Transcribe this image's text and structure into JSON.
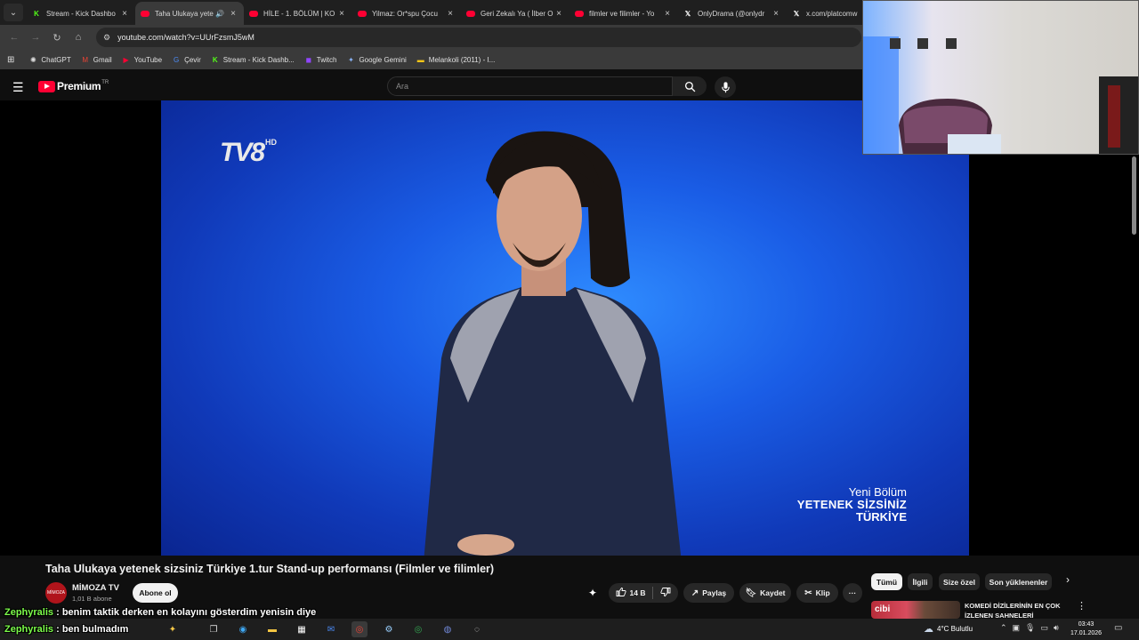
{
  "tabs": [
    {
      "title": "Stream - Kick Dashbo",
      "favicon": "kick-icon",
      "active": false
    },
    {
      "title": "Taha Ulukaya yete",
      "favicon": "youtube-icon",
      "active": true,
      "audio": true
    },
    {
      "title": "HİLE - 1. BÖLÜM | KO",
      "favicon": "youtube-icon",
      "active": false
    },
    {
      "title": "Yilmaz: Or*spu Çocu",
      "favicon": "youtube-icon",
      "active": false
    },
    {
      "title": "Geri Zekalı Ya ( İlber O",
      "favicon": "youtube-icon",
      "active": false
    },
    {
      "title": "filmler ve filimler - Yo",
      "favicon": "youtube-icon",
      "active": false
    },
    {
      "title": "OnlyDrama (@onlydr",
      "favicon": "x-icon",
      "active": false
    },
    {
      "title": "x.com/platcomw",
      "favicon": "x-icon",
      "active": false
    }
  ],
  "address": {
    "url": "youtube.com/watch?v=UUrFzsmJ5wM"
  },
  "bookmarks": [
    {
      "label": "ChatGPT",
      "icon": "chatgpt-icon"
    },
    {
      "label": "Gmail",
      "icon": "gmail-icon"
    },
    {
      "label": "YouTube",
      "icon": "youtube-icon"
    },
    {
      "label": "Çevir",
      "icon": "translate-icon"
    },
    {
      "label": "Stream - Kick Dashb...",
      "icon": "kick-icon"
    },
    {
      "label": "Twitch",
      "icon": "twitch-icon"
    },
    {
      "label": "Google Gemini",
      "icon": "gemini-icon"
    },
    {
      "label": "Melankoli (2011) - I...",
      "icon": "imdb-icon"
    }
  ],
  "masthead": {
    "brand": "Premium",
    "country": "TR",
    "search_placeholder": "Ara"
  },
  "video": {
    "channel_logo": "TV8",
    "channel_logo_hd": "HD",
    "caption_line1": "Yeni Bölüm",
    "caption_line2": "YETENEK SİZSİNİZ",
    "caption_line3": "TÜRKİYE"
  },
  "meta": {
    "title": "Taha Ulukaya yetenek sizsiniz Türkiye 1.tur Stand-up performansı (Filmler ve filimler)",
    "channel": "MİMOZA TV",
    "avatar_text": "MİMOZA",
    "subscribers": "1,01 B abone",
    "subscribe_label": "Abone ol",
    "likes": "14 B",
    "share_label": "Paylaş",
    "save_label": "Kaydet",
    "clip_label": "Klip",
    "more_label": "···"
  },
  "chips": [
    "Tümü",
    "İlgili",
    "Size özel",
    "Son yüklenenler"
  ],
  "recommendation": {
    "thumb_text": "cibi",
    "title": "KOMEDİ DİZİLERİNİN EN ÇOK İZLENEN SAHNELERİ"
  },
  "chat": [
    {
      "user": "Zephyralis",
      "message": "benim taktik derken en kolayını gösterdim yenisin diye"
    },
    {
      "user": "Zephyralis",
      "message": "ben bulmadım"
    }
  ],
  "taskbar": {
    "weather": "4°C  Bulutlu",
    "time": "03:43",
    "date": "17.01.2026"
  },
  "colors": {
    "yt_red": "#ff0033",
    "bg": "#0f0f0f",
    "chat_user": "#7cfc4a"
  }
}
